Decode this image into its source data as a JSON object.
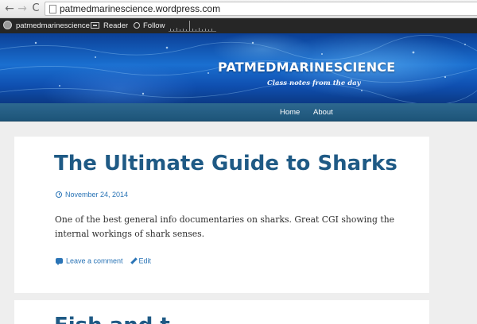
{
  "browser": {
    "url": "patmedmarinescience.wordpress.com",
    "back_glyph": "←",
    "forward_glyph": "→",
    "reload_glyph": "C"
  },
  "admin_bar": {
    "site_label": "patmedmarinescience",
    "reader_label": "Reader",
    "follow_label": "Follow"
  },
  "header": {
    "site_title": "PATMEDMARINESCIENCE",
    "tagline": "Class notes from the day"
  },
  "nav": {
    "items": [
      {
        "label": "Home"
      },
      {
        "label": "About"
      }
    ]
  },
  "posts": [
    {
      "title": "The Ultimate Guide to Sharks",
      "date": "November 24, 2014",
      "body": "One of the best general info documentaries on sharks. Great CGI showing the internal workings of shark senses.",
      "comment_label": "Leave a comment",
      "edit_label": "Edit"
    },
    {
      "title": "Fish and t"
    }
  ],
  "colors": {
    "accent": "#2a74b6",
    "title": "#1f5a85",
    "navbar": "#1f5a80",
    "adminbar": "#262626",
    "page_bg": "#eeeeee"
  }
}
